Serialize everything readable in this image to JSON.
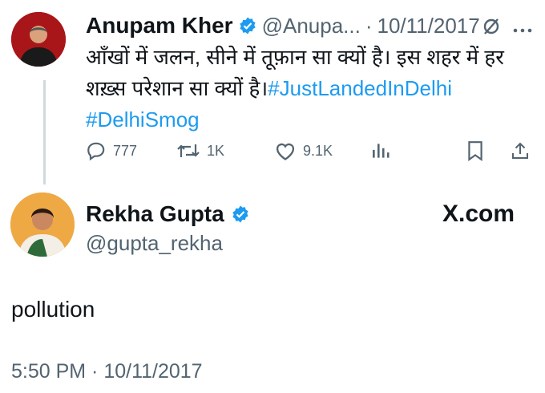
{
  "parent_tweet": {
    "author_name": "Anupam Kher",
    "handle": "@Anupa...",
    "separator": "·",
    "date": "10/11/2017",
    "text_line1": "आँखों में जलन, सीने में तूफ़ान सा क्यों है। इस शहर में हर",
    "text_line2": "शख़्स परेशान सा क्यों है।",
    "hashtag1": "#JustLandedInDelhi",
    "hashtag2": "#DelhiSmog",
    "replies": "777",
    "retweets": "1K",
    "likes": "9.1K",
    "icons": [
      "verified-badge-icon",
      "grok-icon",
      "more-icon",
      "reply-icon",
      "retweet-icon",
      "like-icon",
      "views-icon",
      "bookmark-icon",
      "share-icon"
    ]
  },
  "reply_tweet": {
    "author_name": "Rekha Gupta",
    "handle": "@gupta_rekha",
    "brand": "X.com",
    "text": "pollution",
    "timestamp": "5:50 PM · 10/11/2017"
  },
  "colors": {
    "link": "#1d9bf0",
    "verified": "#1d9bf0",
    "secondary_text": "#536471",
    "thread_line": "#cfd9de"
  }
}
